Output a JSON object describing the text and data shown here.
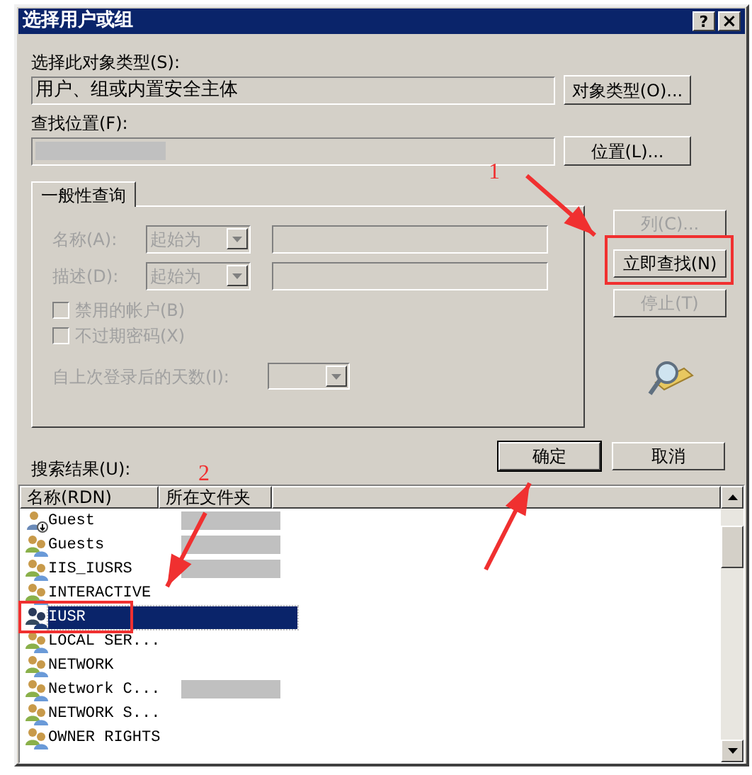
{
  "window": {
    "title": "选择用户或组",
    "help": "?",
    "close": "×"
  },
  "object_type": {
    "label": "选择此对象类型(S):",
    "value": "用户、组或内置安全主体",
    "button": "对象类型(O)..."
  },
  "location": {
    "label": "查找位置(F):",
    "value_redacted": true,
    "button": "位置(L)..."
  },
  "query_tab": {
    "label": "一般性查询",
    "selected": true
  },
  "query": {
    "rows": [
      {
        "label": "名称(A):",
        "combo": "起始为",
        "disabled": true
      },
      {
        "label": "描述(D):",
        "combo": "起始为",
        "disabled": true
      }
    ],
    "checkboxes": [
      {
        "label": "禁用的帐户(B)",
        "checked": false,
        "disabled": true
      },
      {
        "label": "不过期密码(X)",
        "checked": false,
        "disabled": true
      }
    ],
    "days": {
      "label": "自上次登录后的天数(I):",
      "disabled": true
    }
  },
  "side_buttons": [
    {
      "label": "列(C)...",
      "disabled": true
    },
    {
      "label": "立即查找(N)",
      "disabled": false
    },
    {
      "label": "停止(T)",
      "disabled": true
    }
  ],
  "ok_button": "确定",
  "cancel_button": "取消",
  "results": {
    "label": "搜索结果(U):",
    "columns": [
      "名称(RDN)",
      "所在文件夹"
    ],
    "rows": [
      {
        "name": "Guest",
        "kind": "user",
        "folder_redacted": true,
        "selected": false
      },
      {
        "name": "Guests",
        "kind": "group",
        "folder_redacted": true,
        "selected": false
      },
      {
        "name": "IIS_IUSRS",
        "kind": "group",
        "folder_redacted": true,
        "selected": false
      },
      {
        "name": "INTERACTIVE",
        "kind": "group",
        "folder_redacted": false,
        "selected": false
      },
      {
        "name": "IUSR",
        "kind": "group",
        "folder_redacted": false,
        "selected": true
      },
      {
        "name": "LOCAL SER...",
        "kind": "group",
        "folder_redacted": false,
        "selected": false
      },
      {
        "name": "NETWORK",
        "kind": "group",
        "folder_redacted": false,
        "selected": false
      },
      {
        "name": "Network C...",
        "kind": "group",
        "folder_redacted": true,
        "selected": false
      },
      {
        "name": "NETWORK S...",
        "kind": "group",
        "folder_redacted": false,
        "selected": false
      },
      {
        "name": "OWNER RIGHTS",
        "kind": "group",
        "folder_redacted": false,
        "selected": false
      }
    ]
  },
  "annotation_labels": [
    "1",
    "2"
  ]
}
